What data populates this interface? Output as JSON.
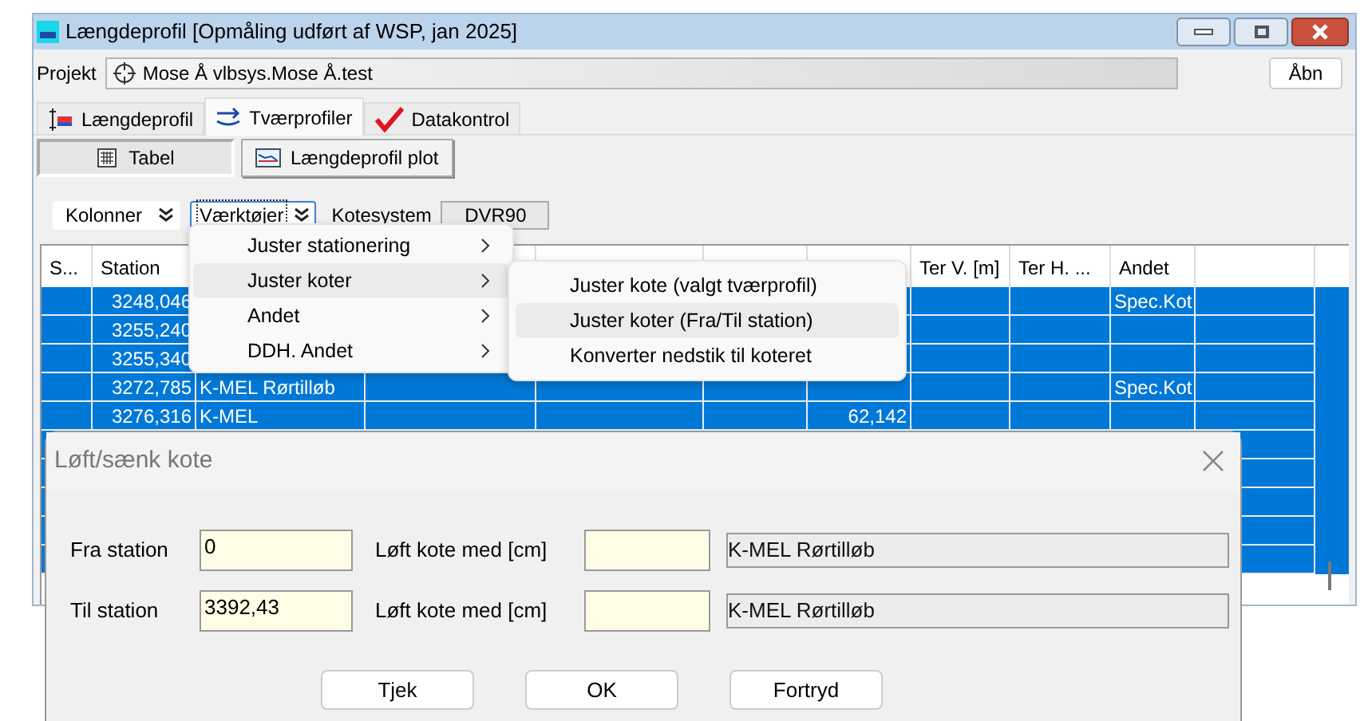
{
  "window": {
    "title": "Længdeprofil [Opmåling udført af WSP, jan 2025]"
  },
  "project": {
    "label": "Projekt",
    "value": "Mose Å vlbsys.Mose Å.test",
    "open_button": "Åbn"
  },
  "tabs": [
    {
      "label": "Længdeprofil",
      "selected": false
    },
    {
      "label": "Tværprofiler",
      "selected": true
    },
    {
      "label": "Datakontrol",
      "selected": false
    }
  ],
  "view_buttons": [
    {
      "label": "Tabel",
      "selected": true
    },
    {
      "label": "Længdeprofil plot",
      "selected": false
    }
  ],
  "toolbar": {
    "columns_button": "Kolonner",
    "tools_button": "Værktøjer",
    "elevation_label": "Kotesystem",
    "elevation_value": "DVR90"
  },
  "table": {
    "columns": [
      "S...",
      "Station",
      "",
      "",
      "",
      "",
      "",
      "Ter V. [m]",
      "Ter H. ...",
      "Andet",
      ""
    ],
    "rows": [
      {
        "selected": true,
        "cells": [
          "",
          "3248,046",
          "",
          "",
          "",
          "",
          "",
          "",
          "",
          "Spec.Kot",
          ""
        ]
      },
      {
        "selected": true,
        "cells": [
          "",
          "3255,240",
          "",
          "",
          "",
          "",
          "",
          "",
          "",
          "",
          ""
        ]
      },
      {
        "selected": true,
        "cells": [
          "",
          "3255,340",
          "",
          "",
          "",
          "",
          "",
          "",
          "",
          "",
          ""
        ]
      },
      {
        "selected": true,
        "cells": [
          "",
          "3272,785",
          "K-MEL Rørtilløb",
          "",
          "",
          "",
          "",
          "",
          "",
          "Spec.Kot",
          ""
        ]
      },
      {
        "selected": true,
        "cells": [
          "",
          "3276,316",
          "K-MEL",
          "",
          "",
          "",
          "62,142",
          "",
          "",
          "",
          ""
        ]
      },
      {
        "selected": true
      },
      {
        "selected": true
      },
      {
        "selected": true
      },
      {
        "selected": true
      },
      {
        "selected": true
      }
    ]
  },
  "menu": {
    "items": [
      {
        "label": "Juster stationering",
        "selected": false
      },
      {
        "label": "Juster koter",
        "selected": true
      },
      {
        "label": "Andet",
        "selected": false
      },
      {
        "label": "DDH. Andet",
        "selected": false
      }
    ]
  },
  "submenu": {
    "items": [
      {
        "label": "Juster kote (valgt tværprofil)",
        "selected": false
      },
      {
        "label": "Juster koter (Fra/Til station)",
        "selected": true
      },
      {
        "label": "Konverter nedstik til koteret",
        "selected": false
      }
    ]
  },
  "dialog": {
    "title": "Løft/sænk kote",
    "rows": [
      {
        "label": "Fra station",
        "value": "0",
        "raise_label": "Løft kote med [cm]",
        "name_value": "K-MEL Rørtilløb"
      },
      {
        "label": "Til station",
        "value": "3392,43",
        "raise_label": "Løft kote med [cm]",
        "name_value": "K-MEL Rørtilløb"
      }
    ],
    "buttons": [
      "Tjek",
      "OK",
      "Fortryd"
    ]
  }
}
